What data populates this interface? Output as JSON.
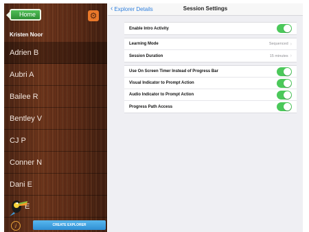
{
  "sidebar": {
    "home_label": "Home",
    "settings_icon": "gear-icon",
    "user_name": "Kristen Noor",
    "explorers": [
      {
        "label": "Adrien B",
        "selected": true
      },
      {
        "label": "Aubri A",
        "selected": false
      },
      {
        "label": "Bailee R",
        "selected": false
      },
      {
        "label": "Bentley V",
        "selected": false
      },
      {
        "label": "CJ P",
        "selected": false
      },
      {
        "label": "Conner N",
        "selected": false
      },
      {
        "label": "Dani E",
        "selected": false
      },
      {
        "label": "E",
        "selected": false
      }
    ],
    "info_glyph": "i",
    "create_label": "CREATE EXPLORER"
  },
  "navbar": {
    "back_label": "Explorer Details",
    "title": "Session Settings"
  },
  "settings": {
    "intro": {
      "label": "Enable Intro Activity",
      "on": true
    },
    "learning_mode": {
      "label": "Learning Mode",
      "value": "Sequenced"
    },
    "session_duration": {
      "label": "Session Duration",
      "value": "15 minutes"
    },
    "timer": {
      "label": "Use On Screen Timer Instead of Progress Bar",
      "on": true
    },
    "visual": {
      "label": "Visual Indicator to Prompt Action",
      "on": true
    },
    "audio": {
      "label": "Audio Indicator to Prompt Action",
      "on": true
    },
    "progress_path": {
      "label": "Progress Path Access",
      "on": true
    }
  },
  "colors": {
    "toggle_on": "#4bc85a",
    "link_blue": "#2f7fdd",
    "home_green": "#3aa842",
    "create_blue": "#3b9be0"
  }
}
